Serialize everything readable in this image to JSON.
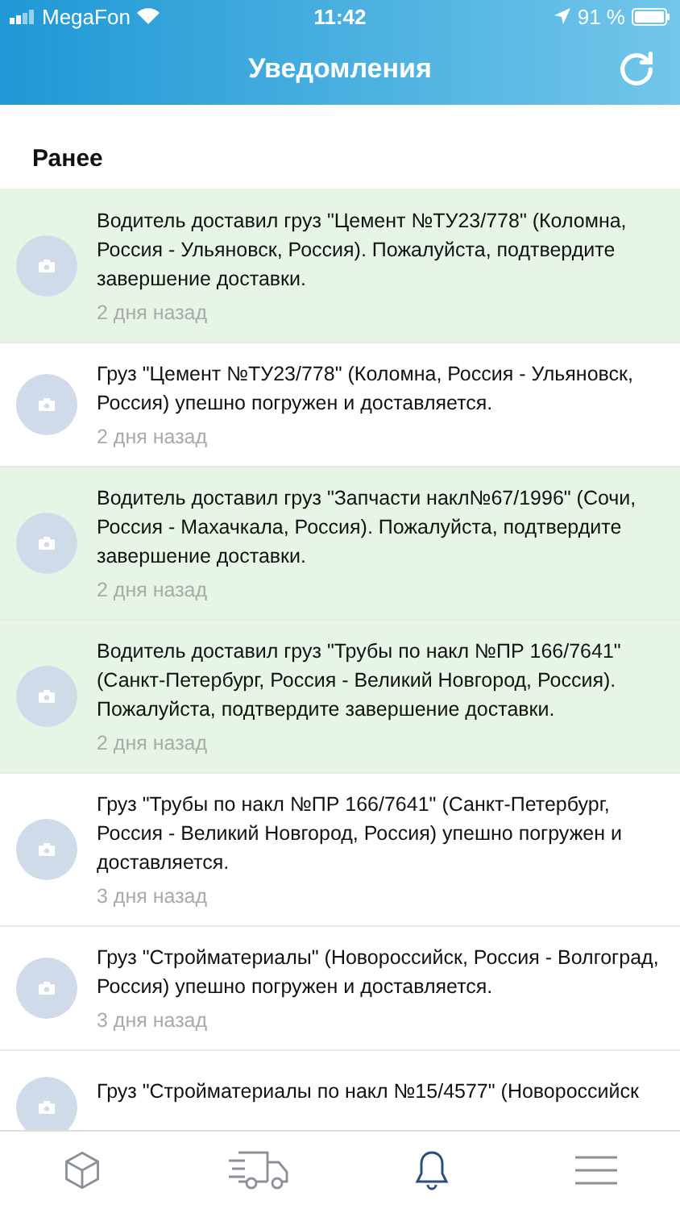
{
  "status_bar": {
    "carrier": "MegaFon",
    "time": "11:42",
    "battery": "91 %"
  },
  "header": {
    "title": "Уведомления"
  },
  "section": {
    "title": "Ранее"
  },
  "notifications": [
    {
      "text": "Водитель доставил груз \"Цемент №ТУ23/778\" (Коломна, Россия - Ульяновск, Россия). Пожалуйста, подтвердите завершение доставки.",
      "time": "2 дня назад",
      "unread": true
    },
    {
      "text": "Груз \"Цемент №ТУ23/778\" (Коломна, Россия - Ульяновск, Россия) упешно погружен и доставляется.",
      "time": "2 дня назад",
      "unread": false
    },
    {
      "text": "Водитель доставил груз \"Запчасти накл№67/1996\" (Сочи, Россия - Махачкала, Россия). Пожалуйста, подтвердите завершение доставки.",
      "time": "2 дня назад",
      "unread": true
    },
    {
      "text": "Водитель доставил груз \"Трубы по накл №ПР 166/7641\" (Санкт-Петербург, Россия - Великий Новгород, Россия). Пожалуйста, подтвердите завершение доставки.",
      "time": "2 дня назад",
      "unread": true
    },
    {
      "text": "Груз \"Трубы по накл №ПР 166/7641\" (Санкт-Петербург, Россия - Великий Новгород, Россия) упешно погружен и доставляется.",
      "time": "3 дня назад",
      "unread": false
    },
    {
      "text": "Груз \"Стройматериалы\" (Новороссийск, Россия - Волгоград, Россия) упешно погружен и доставляется.",
      "time": "3 дня назад",
      "unread": false
    },
    {
      "text": "Груз \"Стройматериалы по накл №15/4577\" (Новороссийск",
      "unread": false
    }
  ],
  "tab_bar": [
    {
      "kind": "cargo",
      "selected": false
    },
    {
      "kind": "delivery",
      "selected": false
    },
    {
      "kind": "notifications",
      "selected": true
    },
    {
      "kind": "menu",
      "selected": false
    }
  ]
}
